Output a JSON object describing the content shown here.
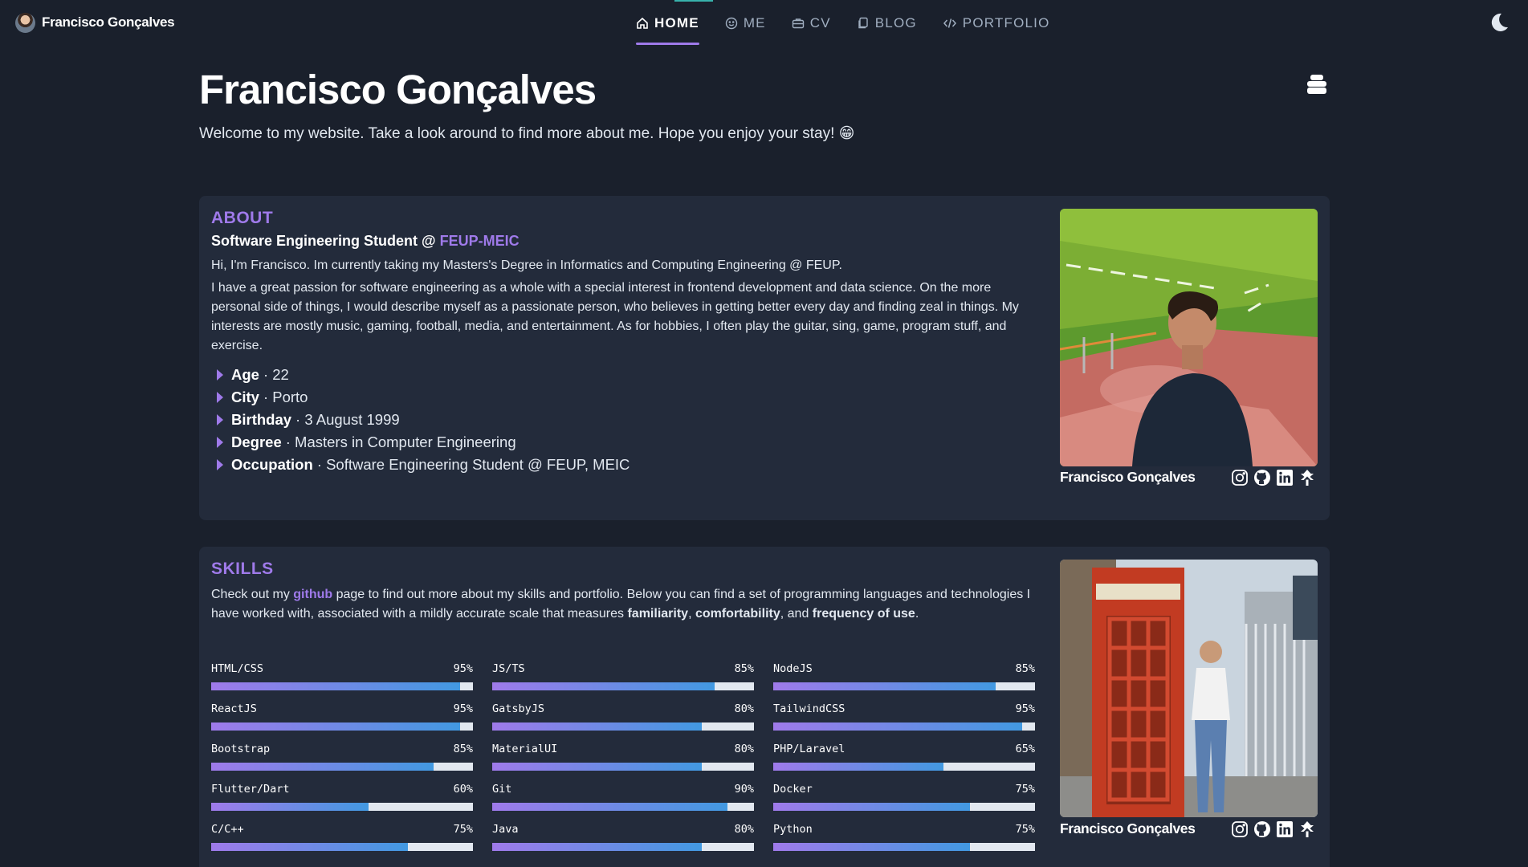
{
  "nav": {
    "brand": "Francisco Gonçalves",
    "links": [
      {
        "label": "HOME",
        "icon": "home-icon",
        "active": true
      },
      {
        "label": "ME",
        "icon": "smile-icon",
        "active": false
      },
      {
        "label": "CV",
        "icon": "briefcase-icon",
        "active": false
      },
      {
        "label": "BLOG",
        "icon": "pages-icon",
        "active": false
      },
      {
        "label": "PORTFOLIO",
        "icon": "code-icon",
        "active": false
      }
    ],
    "theme_icon": "moon-icon"
  },
  "header": {
    "title": "Francisco Gonçalves",
    "subtitle": "Welcome to my website. Take a look around to find more about me. Hope you enjoy your stay! 😁",
    "stack_icon": "stack-icon"
  },
  "about": {
    "title": "ABOUT",
    "subtitle_prefix": "Software Engineering Student @ ",
    "subtitle_accent": "FEUP-MEIC",
    "para1": "Hi, I'm Francisco. Im currently taking my Masters's Degree in Informatics and Computing Engineering @ FEUP.",
    "para2": "I have a great passion for software engineering as a whole with a special interest in frontend development and data science. On the more personal side of things, I would describe myself as a passionate person, who believes in getting better every day and finding zeal in things. My interests are mostly music, gaming, football, media, and entertainment. As for hobbies, I often play the guitar, sing, game, program stuff, and exercise.",
    "facts": [
      {
        "key": "Age",
        "value": "· 22"
      },
      {
        "key": "City",
        "value": "· Porto"
      },
      {
        "key": "Birthday",
        "value": "· 3 August 1999"
      },
      {
        "key": "Degree",
        "value": "· Masters in Computer Engineering"
      },
      {
        "key": "Occupation",
        "value": "· Software Engineering Student @ FEUP, MEIC"
      }
    ],
    "caption": "Francisco Gonçalves"
  },
  "skills": {
    "title": "SKILLS",
    "intro_1": "Check out my ",
    "intro_link": "github",
    "intro_2": " page to find out more about my skills and portfolio. Below you can find a set of programming languages and technologies I have worked with, associated with a mildly accurate scale that measures ",
    "intro_b1": "familiarity",
    "intro_sep1": ", ",
    "intro_b2": "comfortability",
    "intro_sep2": ", and ",
    "intro_b3": "frequency of use",
    "intro_end": ".",
    "items": [
      {
        "name": "HTML/CSS",
        "pct": "95%",
        "value": 95
      },
      {
        "name": "JS/TS",
        "pct": "85%",
        "value": 85
      },
      {
        "name": "NodeJS",
        "pct": "85%",
        "value": 85
      },
      {
        "name": "ReactJS",
        "pct": "95%",
        "value": 95
      },
      {
        "name": "GatsbyJS",
        "pct": "80%",
        "value": 80
      },
      {
        "name": "TailwindCSS",
        "pct": "95%",
        "value": 95
      },
      {
        "name": "Bootstrap",
        "pct": "85%",
        "value": 85
      },
      {
        "name": "MaterialUI",
        "pct": "80%",
        "value": 80
      },
      {
        "name": "PHP/Laravel",
        "pct": "65%",
        "value": 65
      },
      {
        "name": "Flutter/Dart",
        "pct": "60%",
        "value": 60
      },
      {
        "name": "Git",
        "pct": "90%",
        "value": 90
      },
      {
        "name": "Docker",
        "pct": "75%",
        "value": 75
      },
      {
        "name": "C/C++",
        "pct": "75%",
        "value": 75
      },
      {
        "name": "Java",
        "pct": "80%",
        "value": 80
      },
      {
        "name": "Python",
        "pct": "75%",
        "value": 75
      }
    ],
    "caption": "Francisco Gonçalves"
  },
  "socials": [
    "instagram-icon",
    "github-icon",
    "linkedin-icon",
    "linktree-icon"
  ],
  "colors": {
    "background": "#1a202c",
    "card": "#232b3b",
    "accent": "#9f7aea",
    "bar_end": "#4299e1"
  }
}
